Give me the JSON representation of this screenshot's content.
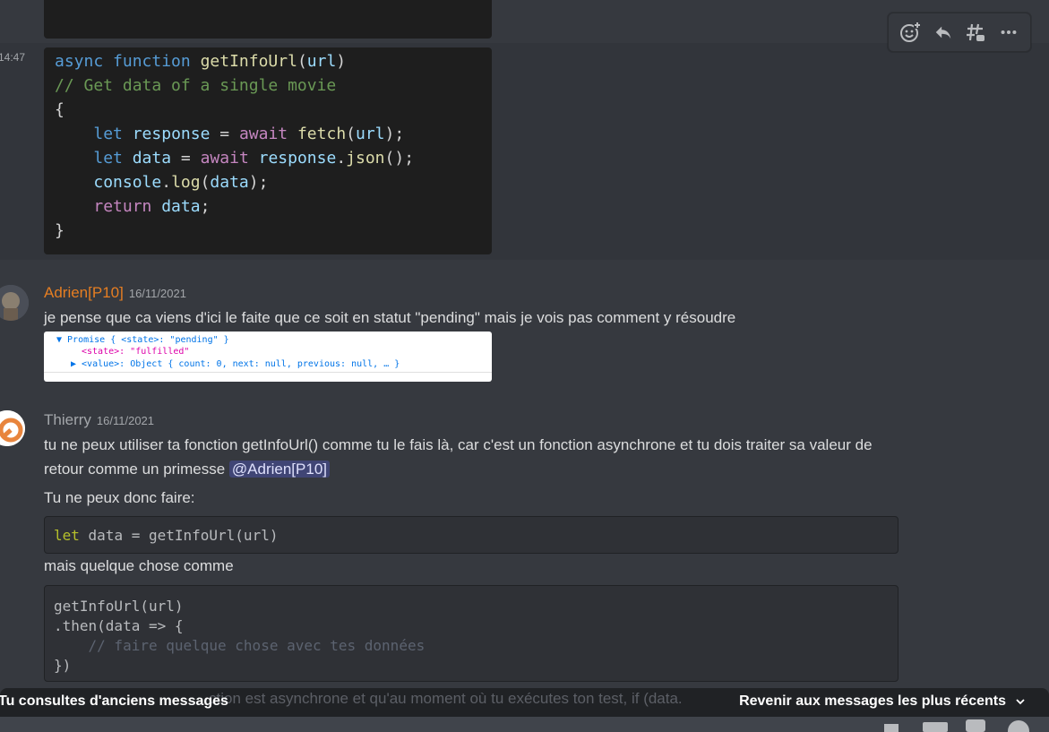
{
  "hover_message": {
    "timestamp": "14:47",
    "code_lines": [
      [
        "async function getInfoUrl(url)"
      ],
      [
        "// Get data of a single movie"
      ],
      [
        "{"
      ],
      [
        "    let response = await fetch(url);"
      ],
      [
        "    let data = await response.json();"
      ],
      [
        "    console.log(data);"
      ],
      [
        "    return data;"
      ],
      [
        "}"
      ]
    ]
  },
  "toolbar": {
    "icons": [
      "add-reaction-icon",
      "reply-icon",
      "create-thread-icon",
      "more-icon"
    ]
  },
  "messages": [
    {
      "author": "Adrien[P10]",
      "author_color": "#e67e22",
      "date": "16/11/2021",
      "text": "je pense que ca viens d'ici le faite que ce soit en statut \"pending\" mais je vois pas comment y résoudre",
      "devtools": {
        "line1": "▼ Promise { <state>: \"pending\" }",
        "line2": "<state>: \"fulfilled\"",
        "line3": "▶ <value>: Object { count: 0, next: null, previous: null, … }"
      }
    },
    {
      "author": "Thierry",
      "author_color": "#a3a6aa",
      "date": "16/11/2021",
      "text_line1": "tu ne peux utiliser ta fonction getInfoUrl() comme tu le fais là, car c'est un fonction asynchrone et tu dois traiter sa valeur de",
      "text_line2_prefix": "retour comme un primesse ",
      "mention": "@Adrien[P10]",
      "text_line3": "Tu ne peux donc faire:",
      "code1_kw": "let",
      "code1_rest": " data = getInfoUrl(url)",
      "text_line4": "mais quelque chose comme",
      "code2_line1": "getInfoUrl(url)",
      "code2_line2": ".then(data => {",
      "code2_line3": "    // faire quelque chose avec tes données",
      "code2_line4": "})"
    }
  ],
  "bottom_bar": {
    "old_messages_label": "Tu consultes d'anciens messages",
    "ghost_text": "ction est asynchrone et qu'au moment où tu exécutes ton test, if (data.",
    "jump_label": "Revenir aux messages les plus récents"
  }
}
